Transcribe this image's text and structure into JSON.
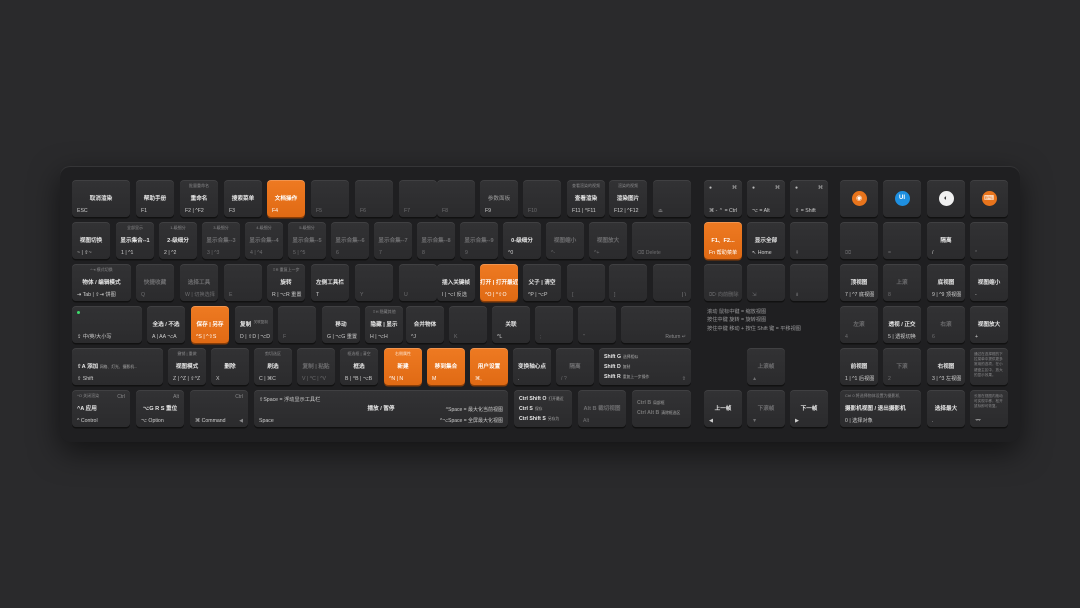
{
  "colors": {
    "accent": "#e8741c",
    "background": "#2a2a2c",
    "keyboard": "#1f1f21",
    "key": "#2f2f31"
  },
  "row1": {
    "esc": {
      "main": "取消渲染",
      "bl": "ESC"
    },
    "f1": {
      "main": "帮助手册",
      "bl": "F1"
    },
    "f2": {
      "top": "批量重命名",
      "main": "重命名",
      "bl": "F2 | ^F2"
    },
    "f3": {
      "main": "搜索菜单",
      "bl": "F3"
    },
    "f4": {
      "main": "文档操作",
      "bl": "F4"
    },
    "f5": "F5",
    "f6": "F6",
    "f7": "F7",
    "f8": "F8",
    "f9": {
      "main": "参数面板",
      "bl": "F9"
    },
    "f10": "F10",
    "f11": {
      "top": "查看渲染的视频",
      "main": "查看渲染",
      "bl": "F11 | ^F11"
    },
    "f12": {
      "top": "渲染的视频",
      "main": "渲染图片",
      "bl": "F12 | ^F12"
    },
    "eject": "⏏",
    "ctrl": "⌘ - ⌃ = Ctrl",
    "alt": "⌥ = Alt",
    "shift": "⇧ = Shift",
    "app_icons": [
      {
        "name": "blender-icon",
        "glyph": "◉",
        "color": "#e8741c"
      },
      {
        "name": "ui-icon",
        "glyph": "UI",
        "color": "#1e8fe0"
      },
      {
        "name": "circle-logo-icon",
        "glyph": "◐",
        "color": "#f0f0f0"
      },
      {
        "name": "keyboard-logo-icon",
        "glyph": "⌨",
        "color": "#e8741c"
      }
    ]
  },
  "row2": {
    "grave": {
      "main": "视图切换",
      "bl": "~ | ⇧~"
    },
    "k1": {
      "top": "全部显示",
      "main": "显示集合--1",
      "bl": "1 | ^1"
    },
    "k2": {
      "top": "1-级细分",
      "main": "2-级细分",
      "bl": "2 | ^2"
    },
    "k3": {
      "top": "3-级细分",
      "main": "显示合集--3",
      "bl": "3 | ^3"
    },
    "k4": {
      "top": "4-级细分",
      "main": "显示合集--4",
      "bl": "4 | ^4"
    },
    "k5": {
      "top": "5-级细分",
      "main": "显示合集--5",
      "bl": "5 | ^5"
    },
    "k6": {
      "main": "显示合集--6",
      "bl": "6"
    },
    "k7": {
      "main": "显示合集--7",
      "bl": "7"
    },
    "k8": {
      "main": "显示合集--8",
      "bl": "8"
    },
    "k9": {
      "main": "显示合集--9",
      "bl": "9"
    },
    "k0": {
      "main": "0-级细分",
      "bl": "^0"
    },
    "minus": {
      "main": "视图缩小",
      "bl": "^-"
    },
    "equal": {
      "main": "视图放大",
      "bl": "^+"
    },
    "del": {
      "bl": "⌫ Delete"
    },
    "fn": {
      "main": "F1、F2...",
      "bl": "Fn 帮助菜单"
    },
    "home": {
      "main": "显示全部",
      "bl": "↖ Home"
    },
    "pgup": "⇞",
    "clear": "⌧",
    "npeq": "=",
    "npdiv": {
      "main": "隔离",
      "bl": "/"
    },
    "npmul": "*"
  },
  "row3": {
    "tab": {
      "top": "^⇥ 模式切换",
      "main": "物体 / 编辑模式",
      "bl": "⇥ Tab | ⇧⇥ 饼图"
    },
    "q": {
      "main": "快捷收藏",
      "bl": "Q"
    },
    "w": {
      "main": "选择工具",
      "bl": "W | 切换选择"
    },
    "e": {
      "bl": "E"
    },
    "r": {
      "top": "⇧R 重复上一步",
      "main": "旋转",
      "bl": "R | ⌥R 重置"
    },
    "t": {
      "main": "左侧工具栏",
      "bl": "T"
    },
    "y": "Y",
    "u": "U",
    "i": {
      "main": "插入关键帧",
      "bl": "I | ⌥I 反选"
    },
    "o": {
      "main": "打开 | 打开最近",
      "bl": "^O | ^⇧O"
    },
    "p": {
      "main": "父子 | 清空",
      "bl": "^P | ⌥P"
    },
    "lb": "[",
    "rb": "]",
    "bs": "| \\",
    "end": "⌦ 向前删除",
    "down": "⇟",
    "pgdn": "⇟",
    "np7": {
      "main": "顶视图",
      "bl": "7 | ^7 底视图"
    },
    "np8": {
      "main": "上滚",
      "bl": "8"
    },
    "np9": {
      "main": "底视图",
      "bl": "9 | ^9 顶视图"
    },
    "npminus": {
      "main": "视图缩小",
      "bl": "-"
    }
  },
  "row4": {
    "caps": {
      "bl": "⇪ 中/英/大小写"
    },
    "a": {
      "main": "全选 / 不选",
      "bl": "A | AA ⌥A"
    },
    "s": {
      "main": "保存 | 另存",
      "bl": "^S | ^⇧S"
    },
    "d": {
      "main": "复制",
      "bl": "D | ⇧D | ⌥D",
      "tr": "关联复制"
    },
    "f": "F",
    "g": {
      "main": "移动",
      "bl": "G | ⌥G 重置"
    },
    "h": {
      "top": "⇧H 隐藏其他",
      "main": "隐藏 | 显示",
      "bl": "H | ⌥H"
    },
    "j": {
      "main": "合并物体",
      "bl": "^J"
    },
    "k": "K",
    "l": {
      "main": "关联",
      "bl": "^L"
    },
    "semi": ";",
    "quote": "\"",
    "ret": "Return ↵",
    "np4": {
      "main": "左滚",
      "bl": "4"
    },
    "np5": {
      "main": "透视 / 正交",
      "bl": "5 | 透视切换"
    },
    "np6": {
      "main": "右滚",
      "bl": "6"
    },
    "npplus": {
      "main": "视图放大",
      "bl": "+"
    }
  },
  "row5": {
    "lshift": {
      "main": "⇧A 添加",
      "small": "网格、灯光、摄影机...",
      "bl": "⇧ Shift"
    },
    "z": {
      "top": "撤销 | 重做",
      "main": "视图模式",
      "bl": "Z | ^Z | ⇧^Z"
    },
    "x": {
      "main": "删除",
      "bl": "X"
    },
    "c": {
      "top": "剪切选区",
      "main": "刷选",
      "bl": "C | ⌘C"
    },
    "v": {
      "main": "复制 | 粘贴",
      "bl": "V | ^C | ^V"
    },
    "b": {
      "top": "框选框 | 清空",
      "main": "框选",
      "bl": "B | ^B | ⌥B"
    },
    "n": {
      "top": "右侧属性",
      "main": "新建",
      "bl": "^N | N"
    },
    "m": {
      "main": "移到集合",
      "bl": "M"
    },
    "comma": {
      "main": "用户设置",
      "bl": "⌘,"
    },
    "period": {
      "main": "变换轴心点",
      "bl": "."
    },
    "slash": {
      "main": "隔离",
      "bl": "/ ?"
    },
    "rshift": {
      "c1": "Shift G",
      "c1s": "选择相似",
      "c2": "Shift D",
      "c2s": "复制",
      "c3": "Shift R",
      "c3s": "重复上一步操作",
      "tr": "⇧"
    },
    "up": {
      "main": "上滚帧",
      "bl": "▲"
    },
    "np1": {
      "main": "前视图",
      "bl": "1 | ^1 后视图"
    },
    "np2": {
      "main": "下滚",
      "bl": "2"
    },
    "np3": {
      "main": "右视图",
      "bl": "3 | ^3 左视图"
    }
  },
  "row6": {
    "lctrl": {
      "top": "^O 关闭渲染",
      "main": "^A 应用",
      "bl": "^ Control",
      "tr": "Ctrl"
    },
    "lopt": {
      "main": "⌥G R S 重位",
      "bl": "⌥ Option",
      "tr": "Alt"
    },
    "lcmd": {
      "bl": "⌘ Command",
      "tr": "Ctrl",
      "br": "◀"
    },
    "space": {
      "tl": "⇧Space = 浮动显示工具栏",
      "main": "播放 / 暂停",
      "bl": "Space",
      "r1": "^Space = 最大化当前视图",
      "r2": "^⌥Space = 全屏最大化视图"
    },
    "rcmd": {
      "c1": "Ctrl Shift O",
      "c1s": "打开最近",
      "c2": "Ctrl S",
      "c2s": "保存",
      "c3": "Ctrl Shift S",
      "c3s": "另存为"
    },
    "ropt": {
      "main": "Alt B 裁切视图",
      "bl": "Alt"
    },
    "rctrl": {
      "c1": "Ctrl B",
      "c1s": "局部框",
      "c2": "Ctrl Alt B",
      "c2s": "清除框选区"
    },
    "left": {
      "main": "上一帧",
      "bl": "◀"
    },
    "downkey": {
      "main": "下滚帧",
      "bl": "▼"
    },
    "right": {
      "main": "下一帧",
      "bl": "▶"
    },
    "np0": {
      "top": "Ctrl 0 将选择物体设置为摄影机",
      "main": "摄影机视图 / 退出摄影机",
      "bl": "0 | 选择对象"
    },
    "npdot": {
      "main": "选择最大",
      "bl": "."
    },
    "npenter": "⌤"
  },
  "mouse_notes": [
    "滚动 鼠标中键 = 缩放视图",
    "按住中键 旋转 = 旋转视图",
    "按住中键 移动 + 按住 Shift 键 = 平移视图"
  ],
  "side_notes": {
    "n1": "通过在选择框的下拉菜单中提供更多常用的选项，在小键盘主区中，放大的显示效果。",
    "n2": "长按在视图内拖动可实现平移，松开鼠标即可恢复。"
  }
}
